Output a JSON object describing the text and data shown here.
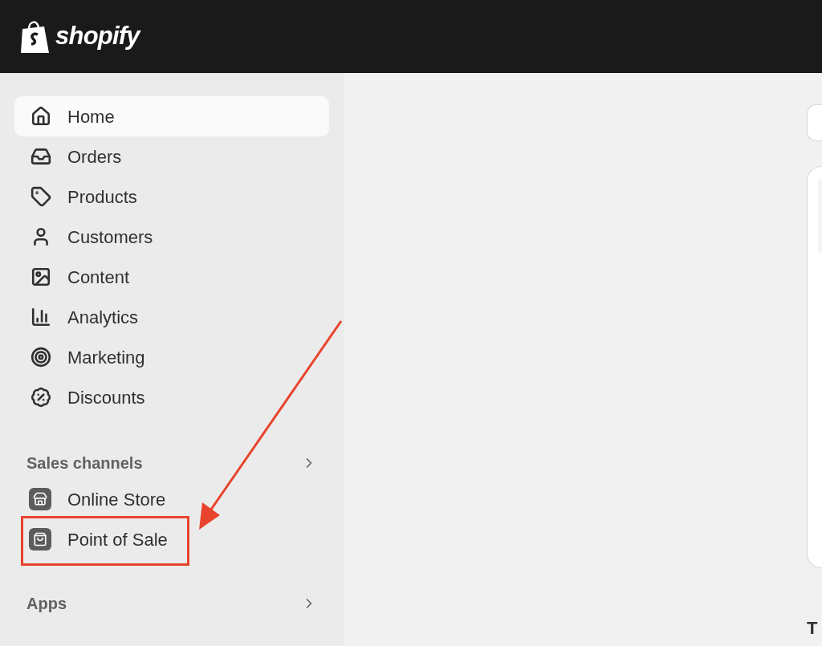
{
  "logo": {
    "text": "shopify"
  },
  "nav": [
    {
      "label": "Home",
      "selected": true
    },
    {
      "label": "Orders",
      "selected": false
    },
    {
      "label": "Products",
      "selected": false
    },
    {
      "label": "Customers",
      "selected": false
    },
    {
      "label": "Content",
      "selected": false
    },
    {
      "label": "Analytics",
      "selected": false
    },
    {
      "label": "Marketing",
      "selected": false
    },
    {
      "label": "Discounts",
      "selected": false
    }
  ],
  "sales_channels": {
    "title": "Sales channels",
    "items": [
      {
        "label": "Online Store",
        "highlighted": false
      },
      {
        "label": "Point of Sale",
        "highlighted": true
      }
    ]
  },
  "apps": {
    "title": "Apps"
  },
  "main": {
    "heading": "T"
  }
}
